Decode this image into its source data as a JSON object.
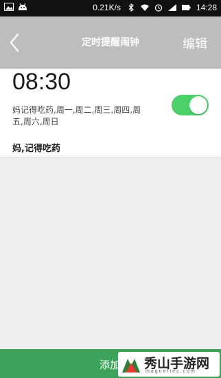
{
  "status_bar": {
    "net_speed": "0.21K/s",
    "time": "14:28",
    "icons": [
      "gallery-icon",
      "android-icon",
      "bluetooth-icon",
      "wifi-icon",
      "alarm-clock-icon",
      "signal-icon",
      "battery-icon"
    ]
  },
  "header": {
    "title": "定时提醒闹钟",
    "edit_label": "编辑",
    "back_icon": "chevron-left-icon"
  },
  "alarm": {
    "time": "08:30",
    "repeat_text": "妈记得吃药,周一,周二,周三,周四,周五,周六,周日",
    "label": "妈,记得吃药",
    "enabled": true
  },
  "footer": {
    "add_label": "添加"
  },
  "watermark": {
    "cn": "秀山手游网",
    "en": "magnettec.com"
  },
  "colors": {
    "header_bg": "#bdbdbd",
    "toggle_on": "#4bd06a",
    "footer_bg": "#3fa25a",
    "page_bg": "#efefef"
  }
}
